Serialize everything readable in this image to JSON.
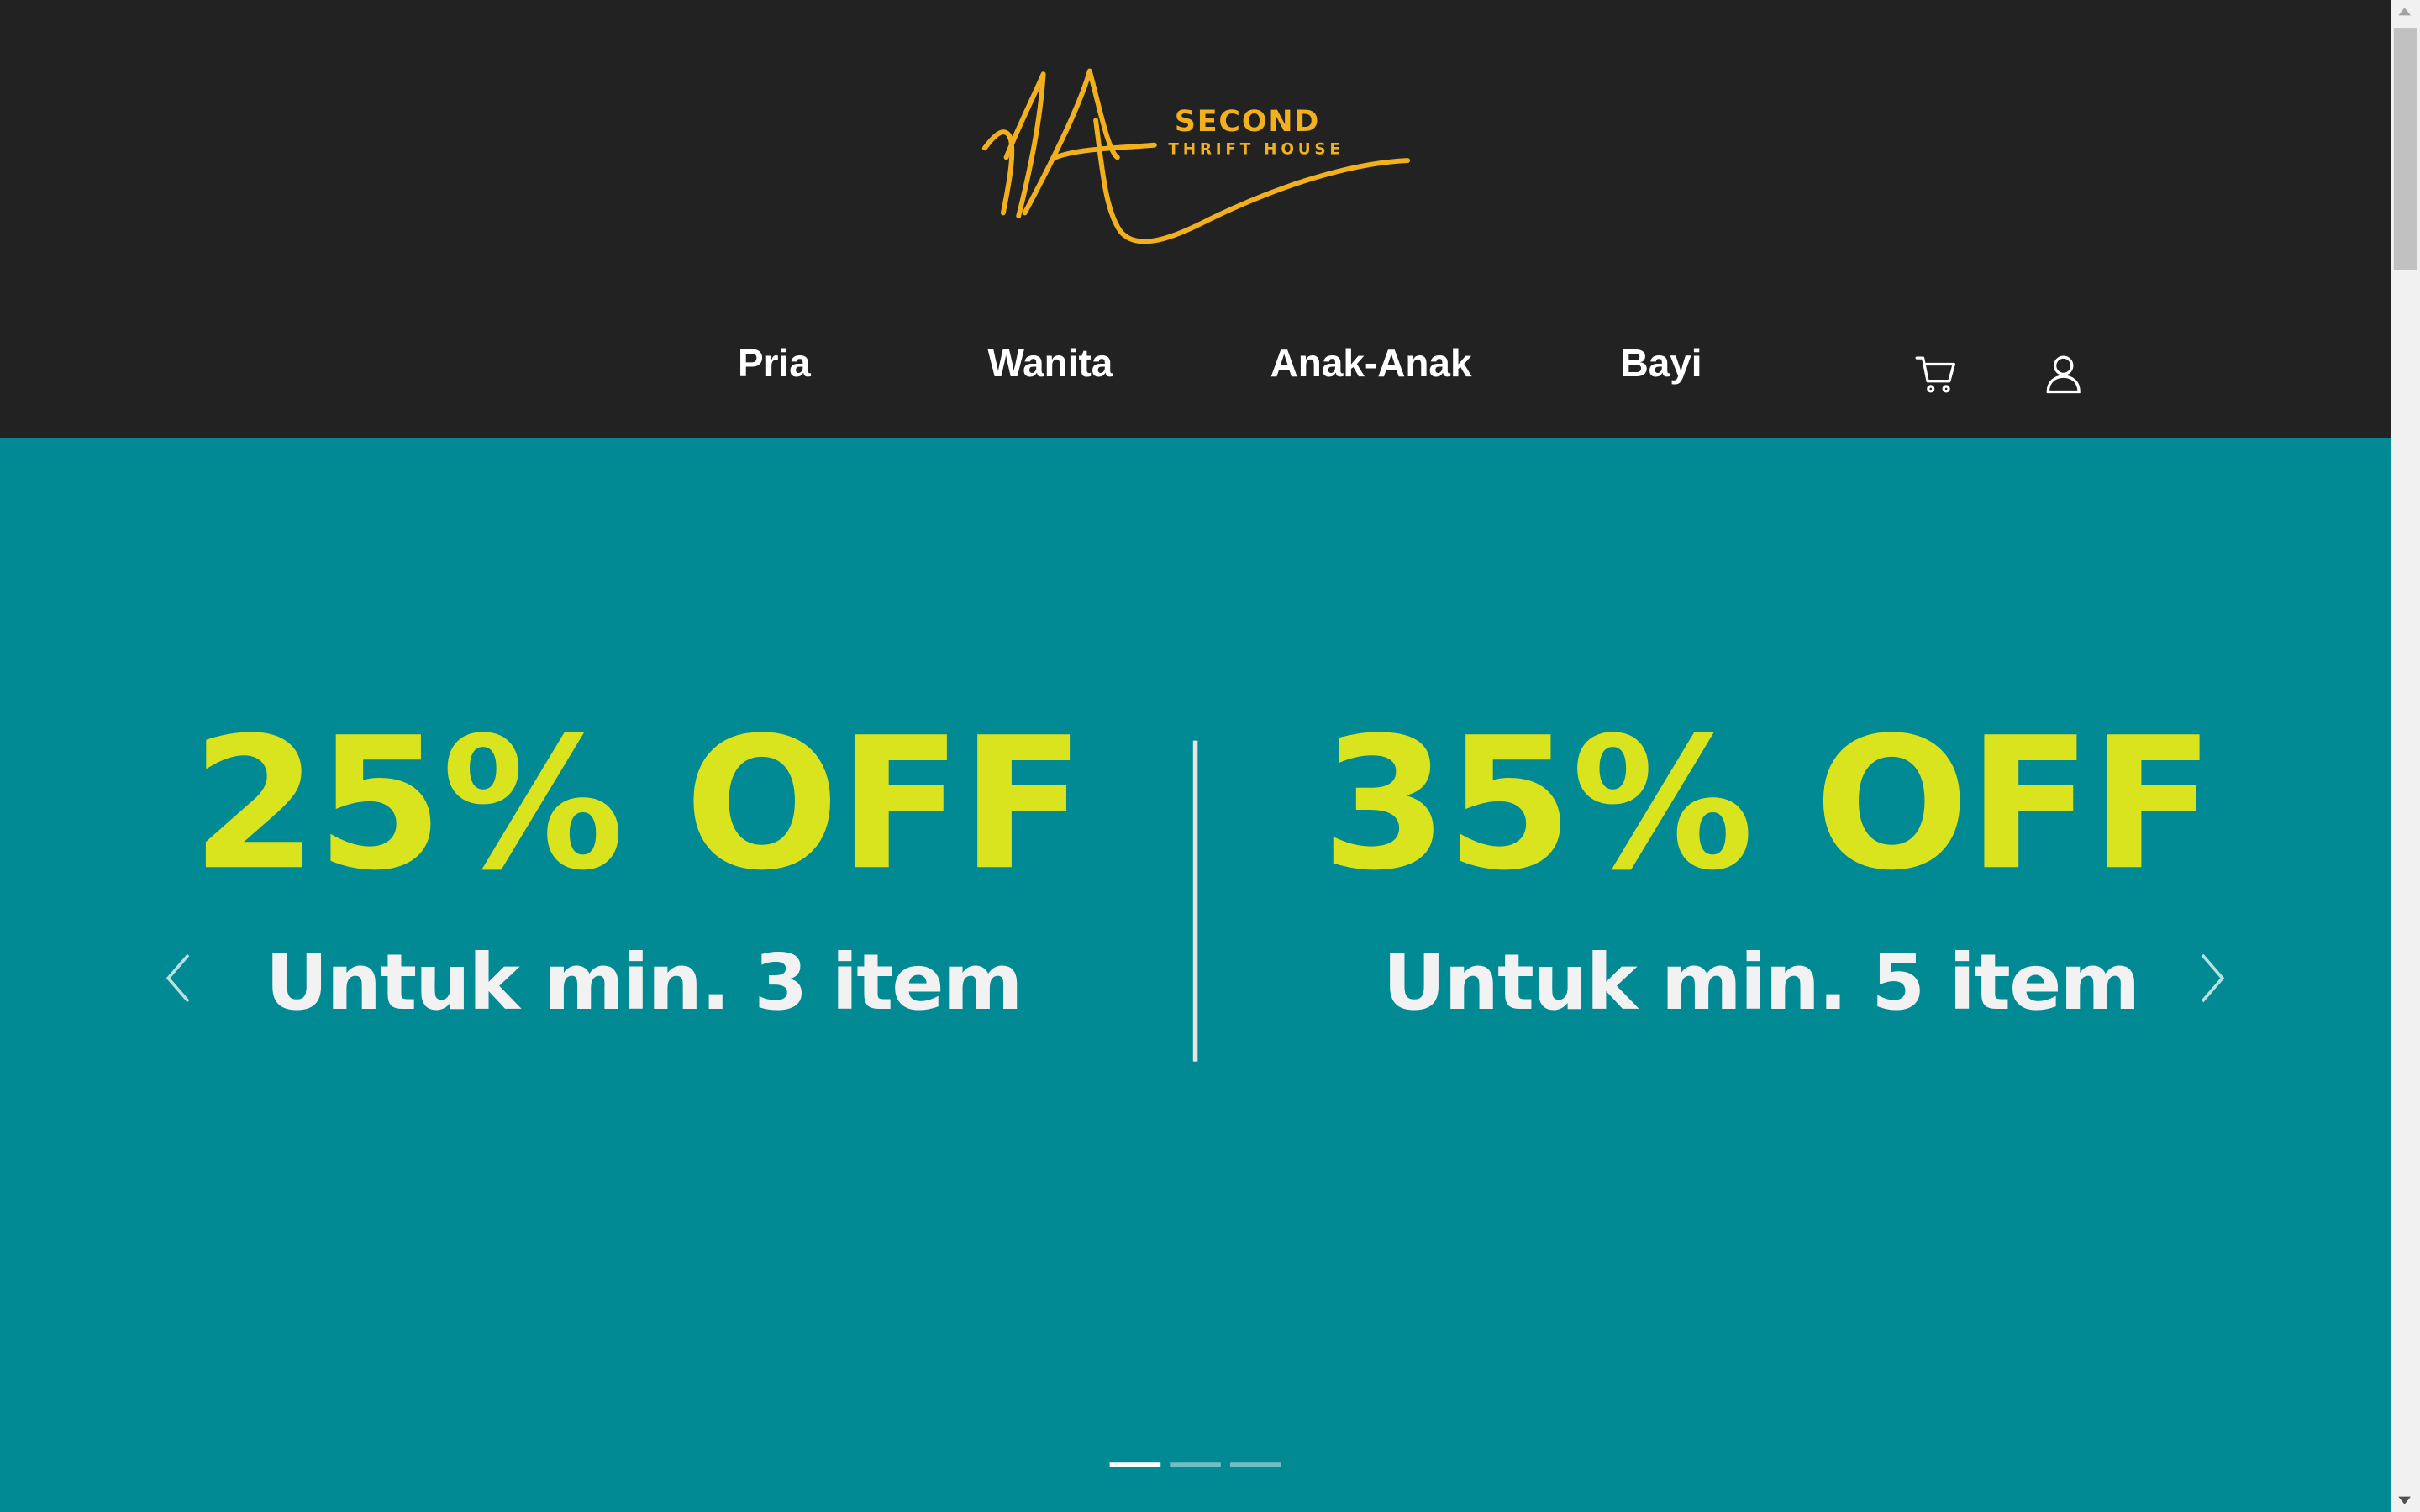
{
  "brand": {
    "second": "SECOND",
    "thrift_house": "THRIFT HOUSE",
    "accent_color": "#f2b01e"
  },
  "nav": {
    "items": [
      {
        "label": "Pria"
      },
      {
        "label": "Wanita"
      },
      {
        "label": "Anak-Anak"
      },
      {
        "label": "Bayi"
      }
    ],
    "icons": [
      "cart-icon",
      "user-icon"
    ]
  },
  "banner": {
    "background": "#018994",
    "offers": [
      {
        "discount": "25% OFF",
        "condition": "Untuk min. 3 item"
      },
      {
        "discount": "35% OFF",
        "condition": "Untuk min. 5 item"
      }
    ],
    "highlight_color": "#d9e31e",
    "slides_total": 3,
    "active_slide": 1
  }
}
